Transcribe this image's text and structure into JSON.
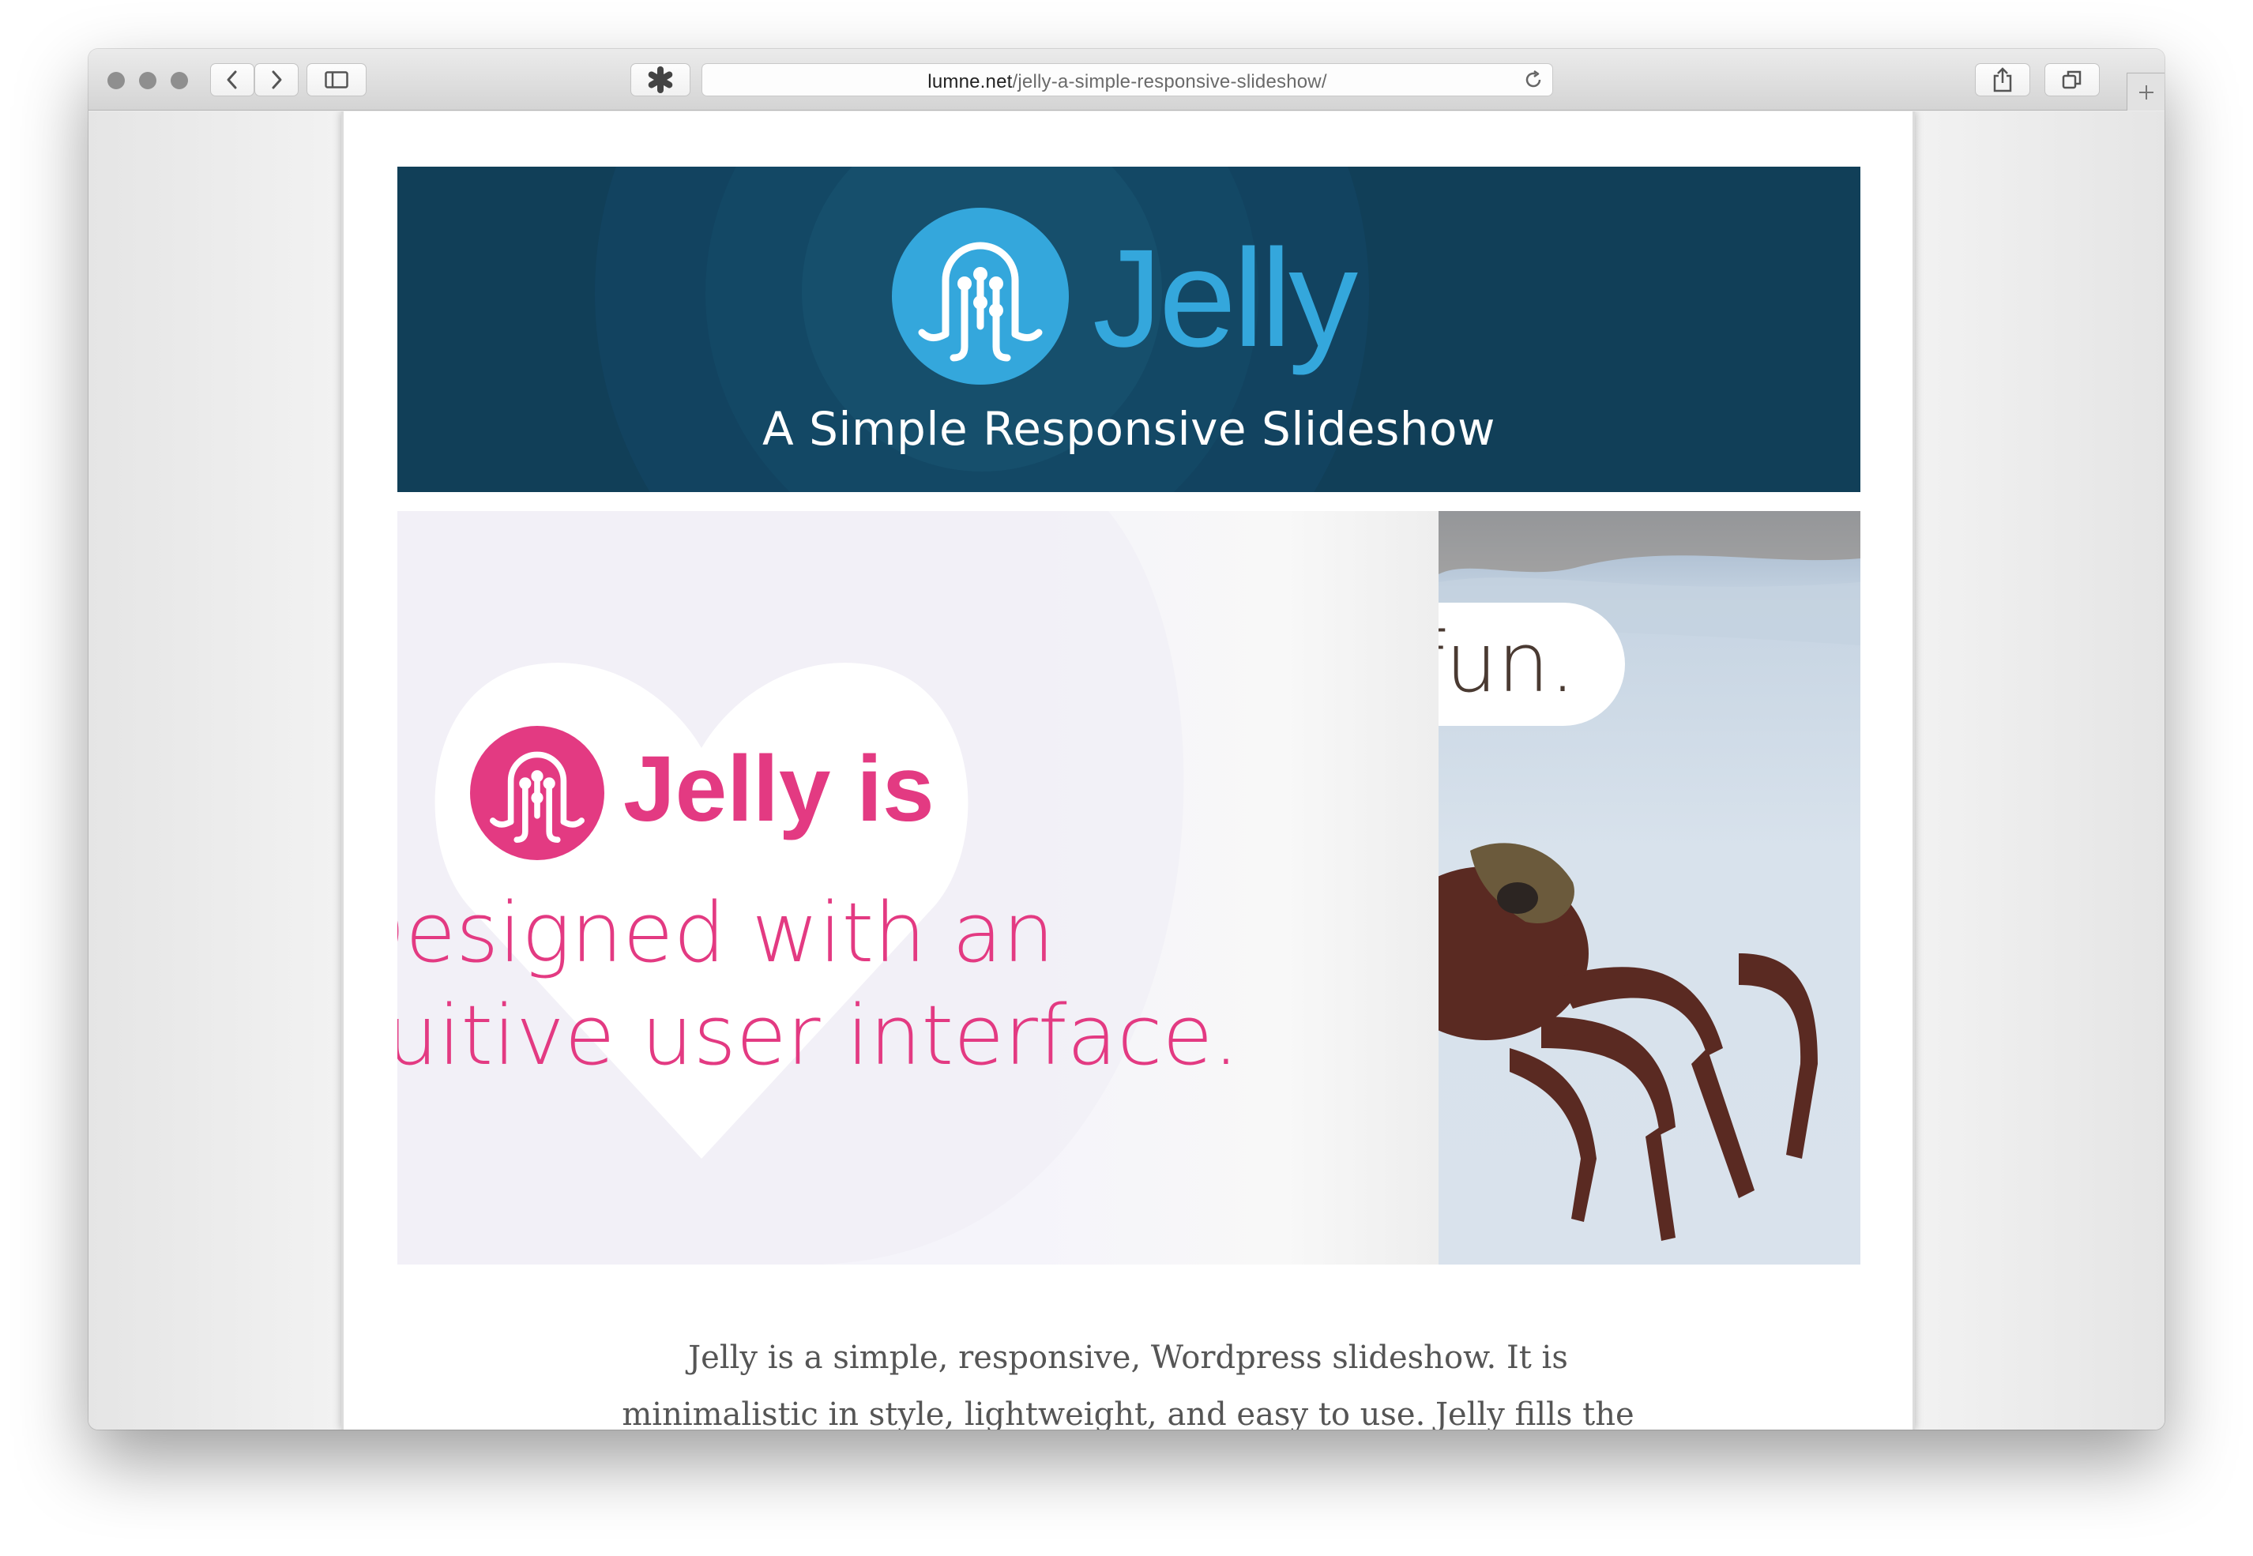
{
  "browser": {
    "url_domain": "lumne.net",
    "url_path": "/jelly-a-simple-responsive-slideshow/",
    "icons": [
      "close-light",
      "minimize-light",
      "zoom-light",
      "back-icon",
      "forward-icon",
      "sidebar-icon",
      "extension-icon",
      "reload-icon",
      "share-icon",
      "tabs-icon",
      "new-tab-icon"
    ]
  },
  "banner": {
    "logo_text": "Jelly",
    "subtitle": "A Simple Responsive Slideshow",
    "background": "#113f58",
    "accent": "#34a7dc"
  },
  "slide": {
    "heading": "Jelly is",
    "line1": "Designed with an",
    "line2": "intuitive user interface.",
    "right_caption": "fun.",
    "accent": "#e33a82"
  },
  "description": {
    "line1": "Jelly is a simple, responsive, Wordpress slideshow. It is",
    "line2": "minimalistic in style, lightweight, and easy to use. Jelly fills the"
  }
}
